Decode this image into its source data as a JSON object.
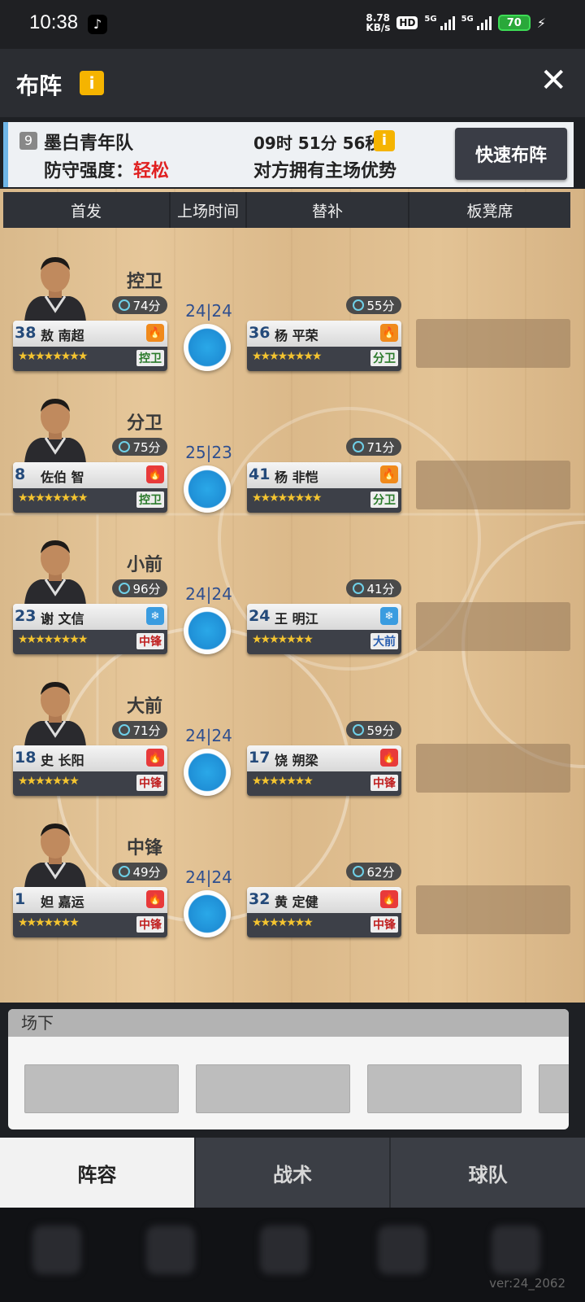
{
  "statusbar": {
    "time": "10:38",
    "speed_top": "8.78",
    "speed_bottom": "KB/s",
    "hd": "HD",
    "net1": "5G",
    "net2": "5G",
    "battery": "70"
  },
  "header": {
    "title": "布阵",
    "info_icon": "i"
  },
  "opponent": {
    "level": "9",
    "name": "墨白青年队",
    "defense_label": "防守强度：",
    "defense_value": "轻松",
    "timer": "09时 51分 56秒",
    "advantage": "对方拥有主场优势",
    "quick_button": "快速布阵"
  },
  "columns": [
    "首发",
    "上场时间",
    "替补",
    "板凳席"
  ],
  "rows": [
    {
      "position": "控卫",
      "split_a": "24",
      "split_b": "24",
      "starter": {
        "number": "38",
        "name": "敖 南超",
        "minutes": "74分",
        "stat": "fire-o",
        "pos": "控卫",
        "pos_color": "g",
        "stars": "★★★★★★★★"
      },
      "sub": {
        "number": "36",
        "name": "杨 平荣",
        "minutes": "55分",
        "stat": "fire-o",
        "pos": "分卫",
        "pos_color": "g",
        "stars": "★★★★★★★★"
      }
    },
    {
      "position": "分卫",
      "split_a": "25",
      "split_b": "23",
      "starter": {
        "number": "8",
        "name": "佐伯 智",
        "minutes": "75分",
        "stat": "fire-r",
        "pos": "控卫",
        "pos_color": "g",
        "stars": "★★★★★★★★"
      },
      "sub": {
        "number": "41",
        "name": "杨 非恺",
        "minutes": "71分",
        "stat": "fire-o",
        "pos": "分卫",
        "pos_color": "g",
        "stars": "★★★★★★★★"
      }
    },
    {
      "position": "小前",
      "split_a": "24",
      "split_b": "24",
      "starter": {
        "number": "23",
        "name": "谢 文信",
        "minutes": "96分",
        "stat": "ice",
        "pos": "中锋",
        "pos_color": "r",
        "stars": "★★★★★★★★"
      },
      "sub": {
        "number": "24",
        "name": "王 明江",
        "minutes": "41分",
        "stat": "ice",
        "pos": "大前",
        "pos_color": "b",
        "stars": "★★★★★★★"
      }
    },
    {
      "position": "大前",
      "split_a": "24",
      "split_b": "24",
      "starter": {
        "number": "18",
        "name": "史 长阳",
        "minutes": "71分",
        "stat": "fire-r",
        "pos": "中锋",
        "pos_color": "r",
        "stars": "★★★★★★★"
      },
      "sub": {
        "number": "17",
        "name": "饶 朔梁",
        "minutes": "59分",
        "stat": "fire-r",
        "pos": "中锋",
        "pos_color": "r",
        "stars": "★★★★★★★"
      }
    },
    {
      "position": "中锋",
      "split_a": "24",
      "split_b": "24",
      "starter": {
        "number": "1",
        "name": "妲 嘉运",
        "minutes": "49分",
        "stat": "fire-r",
        "pos": "中锋",
        "pos_color": "r",
        "stars": "★★★★★★★"
      },
      "sub": {
        "number": "32",
        "name": "黄 定健",
        "minutes": "62分",
        "stat": "fire-r",
        "pos": "中锋",
        "pos_color": "r",
        "stars": "★★★★★★★"
      }
    }
  ],
  "under": {
    "title": "场下"
  },
  "tabs": [
    "阵容",
    "战术",
    "球队"
  ],
  "version": "ver:24_2062"
}
